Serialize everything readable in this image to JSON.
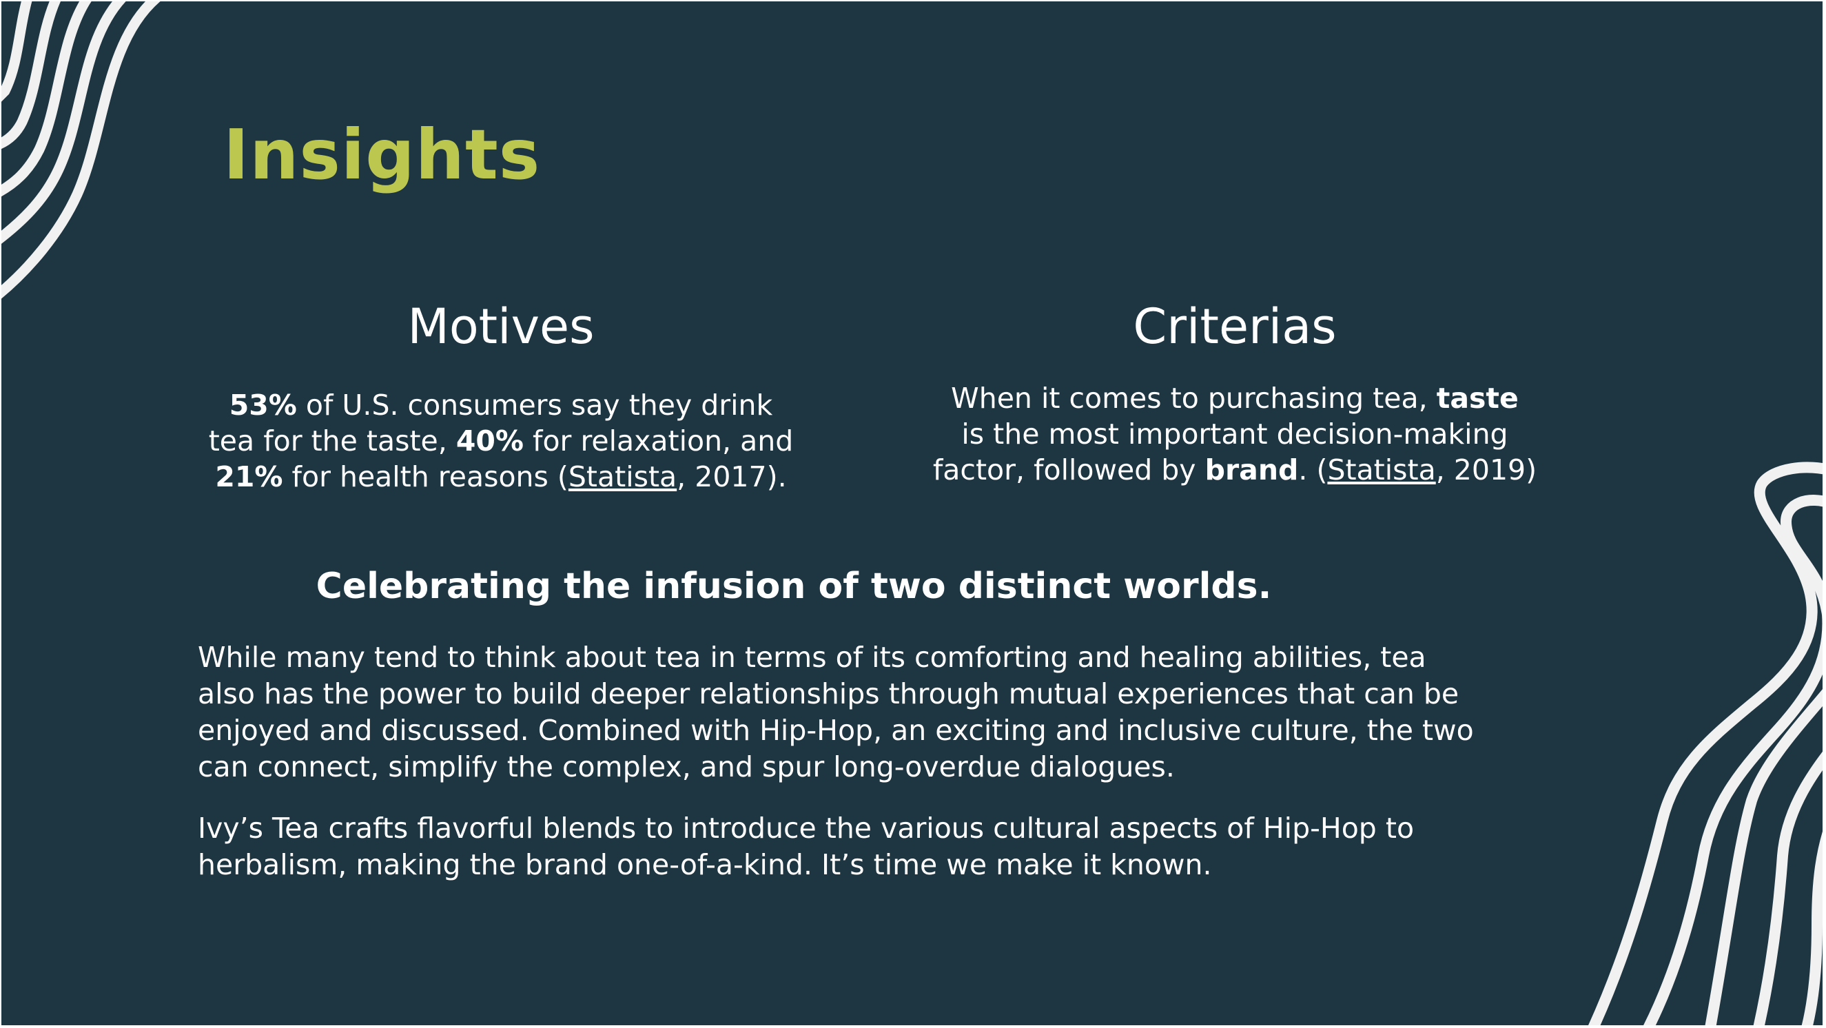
{
  "slide": {
    "title": "Insights",
    "colors": {
      "background": "#1e3542",
      "title_accent": "#bcc74f",
      "text": "#ffffff",
      "decoration": "#f1f1f1"
    },
    "motives": {
      "heading": "Motives",
      "line1": {
        "b1": "53%",
        "t1": " of U.S. consumers say they drink"
      },
      "line2": {
        "t1": "tea for the taste, ",
        "b1": "40%",
        "t2": " for relaxation, and"
      },
      "line3": {
        "b1": "21%",
        "t1": " for health reasons (",
        "link": "Statista",
        "t2": ", 2017)."
      }
    },
    "criterias": {
      "heading": "Criterias",
      "line1": {
        "t1": "When it comes to purchasing tea, ",
        "b1": "taste"
      },
      "line2": {
        "t1": "is the most important decision-making"
      },
      "line3": {
        "t1": "factor, followed by ",
        "b1": "brand",
        "t2": ". (",
        "link": "Statista",
        "t3": ", 2019)"
      }
    },
    "subheading": "Celebrating the infusion of two distinct worlds.",
    "paragraph1": [
      "While many tend to think about tea in terms of its comforting and healing abilities, tea",
      "also has the power to build deeper relationships through mutual experiences that can be",
      "enjoyed and discussed. Combined with Hip-Hop, an exciting and inclusive culture, the two",
      "can connect, simplify the complex, and spur long-overdue dialogues."
    ],
    "paragraph2": [
      "Ivy’s Tea crafts flavorful blends to introduce the various cultural aspects of Hip-Hop to",
      "herbalism, making the brand one-of-a-kind. It’s time we make it known."
    ],
    "decorations": [
      "wavy-stripes-top-left",
      "wavy-stripes-bottom-right"
    ]
  }
}
